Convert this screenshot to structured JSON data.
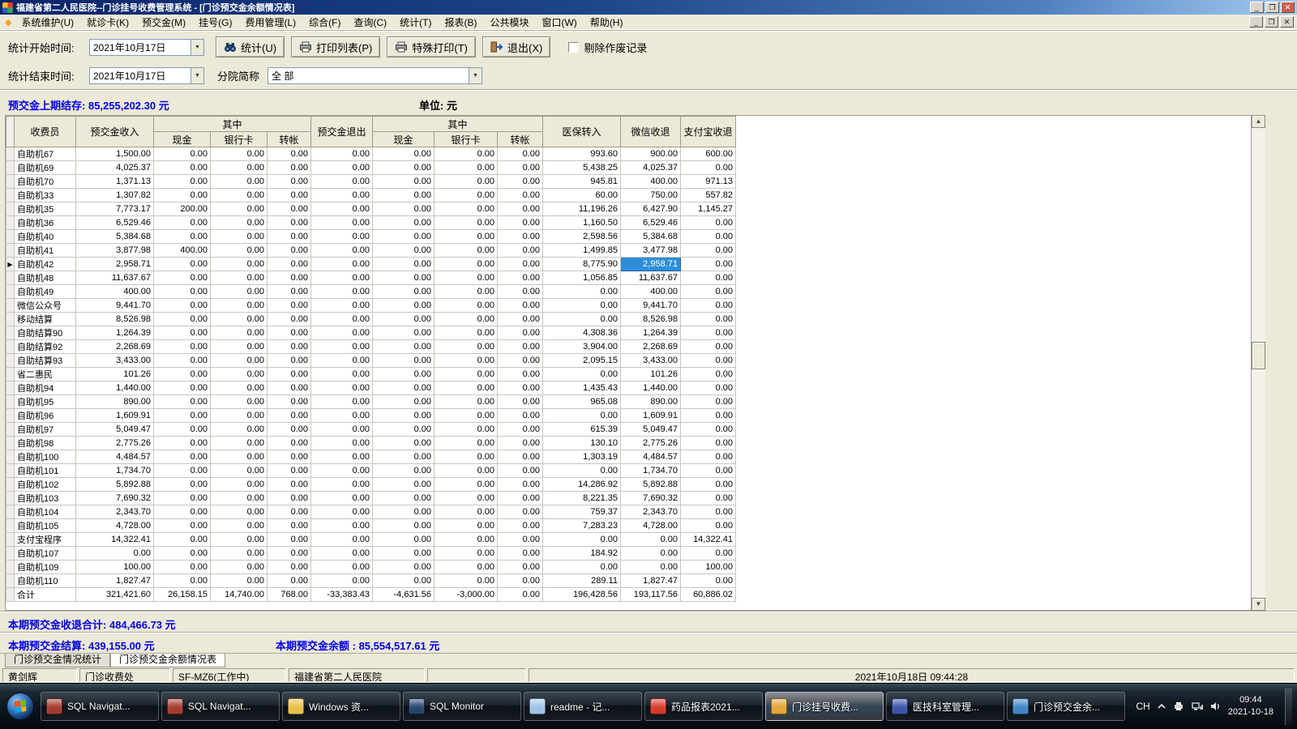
{
  "colors": {
    "accent-blue": "#0000e0",
    "selection-bg": "#2e8fd8"
  },
  "titlebar": {
    "title": "福建省第二人民医院--门诊挂号收费管理系统 - [门诊预交金余额情况表]"
  },
  "menubar": {
    "items": [
      "系统维护(U)",
      "就诊卡(K)",
      "预交金(M)",
      "挂号(G)",
      "费用管理(L)",
      "综合(F)",
      "查询(C)",
      "统计(T)",
      "报表(B)",
      "公共模块",
      "窗口(W)",
      "帮助(H)"
    ]
  },
  "toolbar": {
    "start_time_label": "统计开始时间:",
    "start_time_value": "2021年10月17日",
    "end_time_label": "统计结束时间:",
    "end_time_value": "2021年10月17日",
    "branch_label": "分院简称",
    "branch_value": "全 部",
    "buttons": {
      "stat": "统计(U)",
      "print_list": "打印列表(P)",
      "special_print": "特殊打印(T)",
      "exit": "退出(X)"
    },
    "exclude_void_label": "剔除作废记录"
  },
  "summary_top": {
    "label": "预交金上期结存:",
    "value": "85,255,202.30 元",
    "unit": "单位: 元"
  },
  "table": {
    "header": {
      "cashier": "收费员",
      "deposit_in": "预交金收入",
      "including_in": "其中",
      "cash_in": "现金",
      "card_in": "银行卡",
      "transfer_in": "转帐",
      "deposit_out": "预交金退出",
      "including_out": "其中",
      "cash_out": "现金",
      "card_out": "银行卡",
      "transfer_out": "转帐",
      "medicare_in": "医保转入",
      "wechat": "微信收退",
      "alipay": "支付宝收退"
    },
    "selected": {
      "row_index": 8,
      "value_index": 9
    },
    "rows": [
      {
        "name": "自助机67",
        "values": [
          "1,500.00",
          "0.00",
          "0.00",
          "0.00",
          "0.00",
          "0.00",
          "0.00",
          "0.00",
          "993.60",
          "900.00",
          "600.00"
        ]
      },
      {
        "name": "自助机69",
        "values": [
          "4,025.37",
          "0.00",
          "0.00",
          "0.00",
          "0.00",
          "0.00",
          "0.00",
          "0.00",
          "5,438.25",
          "4,025.37",
          "0.00"
        ]
      },
      {
        "name": "自助机70",
        "values": [
          "1,371.13",
          "0.00",
          "0.00",
          "0.00",
          "0.00",
          "0.00",
          "0.00",
          "0.00",
          "945.81",
          "400.00",
          "971.13"
        ]
      },
      {
        "name": "自助机33",
        "values": [
          "1,307.82",
          "0.00",
          "0.00",
          "0.00",
          "0.00",
          "0.00",
          "0.00",
          "0.00",
          "60.00",
          "750.00",
          "557.82"
        ]
      },
      {
        "name": "自助机35",
        "values": [
          "7,773.17",
          "200.00",
          "0.00",
          "0.00",
          "0.00",
          "0.00",
          "0.00",
          "0.00",
          "11,196.26",
          "6,427.90",
          "1,145.27"
        ]
      },
      {
        "name": "自助机36",
        "values": [
          "6,529.46",
          "0.00",
          "0.00",
          "0.00",
          "0.00",
          "0.00",
          "0.00",
          "0.00",
          "1,160.50",
          "6,529.46",
          "0.00"
        ]
      },
      {
        "name": "自助机40",
        "values": [
          "5,384.68",
          "0.00",
          "0.00",
          "0.00",
          "0.00",
          "0.00",
          "0.00",
          "0.00",
          "2,598.56",
          "5,384.68",
          "0.00"
        ]
      },
      {
        "name": "自助机41",
        "values": [
          "3,877.98",
          "400.00",
          "0.00",
          "0.00",
          "0.00",
          "0.00",
          "0.00",
          "0.00",
          "1,499.85",
          "3,477.98",
          "0.00"
        ]
      },
      {
        "name": "自助机42",
        "values": [
          "2,958.71",
          "0.00",
          "0.00",
          "0.00",
          "0.00",
          "0.00",
          "0.00",
          "0.00",
          "8,775.90",
          "2,958.71",
          "0.00"
        ]
      },
      {
        "name": "自助机48",
        "values": [
          "11,637.67",
          "0.00",
          "0.00",
          "0.00",
          "0.00",
          "0.00",
          "0.00",
          "0.00",
          "1,056.85",
          "11,637.67",
          "0.00"
        ]
      },
      {
        "name": "自助机49",
        "values": [
          "400.00",
          "0.00",
          "0.00",
          "0.00",
          "0.00",
          "0.00",
          "0.00",
          "0.00",
          "0.00",
          "400.00",
          "0.00"
        ]
      },
      {
        "name": "微信公众号",
        "values": [
          "9,441.70",
          "0.00",
          "0.00",
          "0.00",
          "0.00",
          "0.00",
          "0.00",
          "0.00",
          "0.00",
          "9,441.70",
          "0.00"
        ]
      },
      {
        "name": "移动结算",
        "values": [
          "8,526.98",
          "0.00",
          "0.00",
          "0.00",
          "0.00",
          "0.00",
          "0.00",
          "0.00",
          "0.00",
          "8,526.98",
          "0.00"
        ]
      },
      {
        "name": "自助结算90",
        "values": [
          "1,264.39",
          "0.00",
          "0.00",
          "0.00",
          "0.00",
          "0.00",
          "0.00",
          "0.00",
          "4,308.36",
          "1,264.39",
          "0.00"
        ]
      },
      {
        "name": "自助结算92",
        "values": [
          "2,268.69",
          "0.00",
          "0.00",
          "0.00",
          "0.00",
          "0.00",
          "0.00",
          "0.00",
          "3,904.00",
          "2,268.69",
          "0.00"
        ]
      },
      {
        "name": "自助结算93",
        "values": [
          "3,433.00",
          "0.00",
          "0.00",
          "0.00",
          "0.00",
          "0.00",
          "0.00",
          "0.00",
          "2,095.15",
          "3,433.00",
          "0.00"
        ]
      },
      {
        "name": "省二惠民",
        "values": [
          "101.26",
          "0.00",
          "0.00",
          "0.00",
          "0.00",
          "0.00",
          "0.00",
          "0.00",
          "0.00",
          "101.26",
          "0.00"
        ]
      },
      {
        "name": "自助机94",
        "values": [
          "1,440.00",
          "0.00",
          "0.00",
          "0.00",
          "0.00",
          "0.00",
          "0.00",
          "0.00",
          "1,435.43",
          "1,440.00",
          "0.00"
        ]
      },
      {
        "name": "自助机95",
        "values": [
          "890.00",
          "0.00",
          "0.00",
          "0.00",
          "0.00",
          "0.00",
          "0.00",
          "0.00",
          "965.08",
          "890.00",
          "0.00"
        ]
      },
      {
        "name": "自助机96",
        "values": [
          "1,609.91",
          "0.00",
          "0.00",
          "0.00",
          "0.00",
          "0.00",
          "0.00",
          "0.00",
          "0.00",
          "1,609.91",
          "0.00"
        ]
      },
      {
        "name": "自助机97",
        "values": [
          "5,049.47",
          "0.00",
          "0.00",
          "0.00",
          "0.00",
          "0.00",
          "0.00",
          "0.00",
          "615.39",
          "5,049.47",
          "0.00"
        ]
      },
      {
        "name": "自助机98",
        "values": [
          "2,775.26",
          "0.00",
          "0.00",
          "0.00",
          "0.00",
          "0.00",
          "0.00",
          "0.00",
          "130.10",
          "2,775.26",
          "0.00"
        ]
      },
      {
        "name": "自助机100",
        "values": [
          "4,484.57",
          "0.00",
          "0.00",
          "0.00",
          "0.00",
          "0.00",
          "0.00",
          "0.00",
          "1,303.19",
          "4,484.57",
          "0.00"
        ]
      },
      {
        "name": "自助机101",
        "values": [
          "1,734.70",
          "0.00",
          "0.00",
          "0.00",
          "0.00",
          "0.00",
          "0.00",
          "0.00",
          "0.00",
          "1,734.70",
          "0.00"
        ]
      },
      {
        "name": "自助机102",
        "values": [
          "5,892.88",
          "0.00",
          "0.00",
          "0.00",
          "0.00",
          "0.00",
          "0.00",
          "0.00",
          "14,286.92",
          "5,892.88",
          "0.00"
        ]
      },
      {
        "name": "自助机103",
        "values": [
          "7,690.32",
          "0.00",
          "0.00",
          "0.00",
          "0.00",
          "0.00",
          "0.00",
          "0.00",
          "8,221.35",
          "7,690.32",
          "0.00"
        ]
      },
      {
        "name": "自助机104",
        "values": [
          "2,343.70",
          "0.00",
          "0.00",
          "0.00",
          "0.00",
          "0.00",
          "0.00",
          "0.00",
          "759.37",
          "2,343.70",
          "0.00"
        ]
      },
      {
        "name": "自助机105",
        "values": [
          "4,728.00",
          "0.00",
          "0.00",
          "0.00",
          "0.00",
          "0.00",
          "0.00",
          "0.00",
          "7,283.23",
          "4,728.00",
          "0.00"
        ]
      },
      {
        "name": "支付宝程序",
        "values": [
          "14,322.41",
          "0.00",
          "0.00",
          "0.00",
          "0.00",
          "0.00",
          "0.00",
          "0.00",
          "0.00",
          "0.00",
          "14,322.41"
        ]
      },
      {
        "name": "自助机107",
        "values": [
          "0.00",
          "0.00",
          "0.00",
          "0.00",
          "0.00",
          "0.00",
          "0.00",
          "0.00",
          "184.92",
          "0.00",
          "0.00"
        ]
      },
      {
        "name": "自助机109",
        "values": [
          "100.00",
          "0.00",
          "0.00",
          "0.00",
          "0.00",
          "0.00",
          "0.00",
          "0.00",
          "0.00",
          "0.00",
          "100.00"
        ]
      },
      {
        "name": "自助机110",
        "values": [
          "1,827.47",
          "0.00",
          "0.00",
          "0.00",
          "0.00",
          "0.00",
          "0.00",
          "0.00",
          "289.11",
          "1,827.47",
          "0.00"
        ]
      },
      {
        "name": "合计",
        "values": [
          "321,421.60",
          "26,158.15",
          "14,740.00",
          "768.00",
          "-33,383.43",
          "-4,631.56",
          "-3,000.00",
          "0.00",
          "196,428.56",
          "193,117.56",
          "60,886.02"
        ]
      }
    ]
  },
  "summary_bottom": {
    "total_label": "本期预交金收退合计:",
    "total_value": "484,466.73 元",
    "settle_label": "本期预交金结算:",
    "settle_value": "439,155.00 元",
    "balance_label": "本期预交金余额 :",
    "balance_value": "85,554,517.61 元"
  },
  "tabs": [
    {
      "label": "门诊预交金情况统计",
      "active": false
    },
    {
      "label": "门诊预交金余额情况表",
      "active": true
    }
  ],
  "statusbar": {
    "segments": [
      "黄剑辉",
      "门诊收费处",
      "SF-MZ6(工作中)",
      "福建省第二人民医院",
      "",
      "2021年10月18日  09:44:28"
    ]
  },
  "taskbar": {
    "buttons": [
      {
        "label": "SQL Navigat...",
        "icon": "sql-navigator-icon",
        "icon_color": "#a33b2e",
        "active": false
      },
      {
        "label": "SQL Navigat...",
        "icon": "sql-navigator-icon",
        "icon_color": "#a33b2e",
        "active": false
      },
      {
        "label": "Windows 资...",
        "icon": "folder-icon",
        "icon_color": "#e8c04a",
        "active": false
      },
      {
        "label": "SQL Monitor",
        "icon": "sql-monitor-icon",
        "icon_color": "#27456e",
        "active": false
      },
      {
        "label": "readme - 记...",
        "icon": "notepad-icon",
        "icon_color": "#9ec3e8",
        "active": false
      },
      {
        "label": "药品报表2021...",
        "icon": "report-app-icon",
        "icon_color": "#d43a2a",
        "active": false
      },
      {
        "label": "门诊挂号收费...",
        "icon": "registration-app-icon",
        "icon_color": "#e2a53a",
        "active": true
      },
      {
        "label": "医技科室管理...",
        "icon": "medical-dept-app-icon",
        "icon_color": "#3a55a8",
        "active": false
      },
      {
        "label": "门诊预交金余...",
        "icon": "deposit-report-app-icon",
        "icon_color": "#3f86c8",
        "active": false
      }
    ],
    "tray": {
      "lang": "CH",
      "clock_time": "09:44",
      "clock_date": "2021-10-18"
    }
  }
}
